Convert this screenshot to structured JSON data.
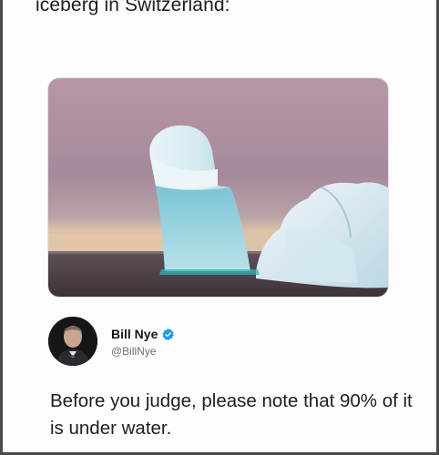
{
  "caption": "iceberg in Switzerland:",
  "image": {
    "icon": "iceberg-photo",
    "colors": {
      "sky": "#a9909f",
      "sea": "#4a3f44",
      "ice": "#cfe6ef"
    }
  },
  "tweet": {
    "author_name": "Bill Nye",
    "handle": "@BillNye",
    "verified_icon": "verified-badge-icon",
    "text": "Before you judge, please note that 90% of it is under water."
  },
  "colors": {
    "verified": "#1d9bf0"
  }
}
